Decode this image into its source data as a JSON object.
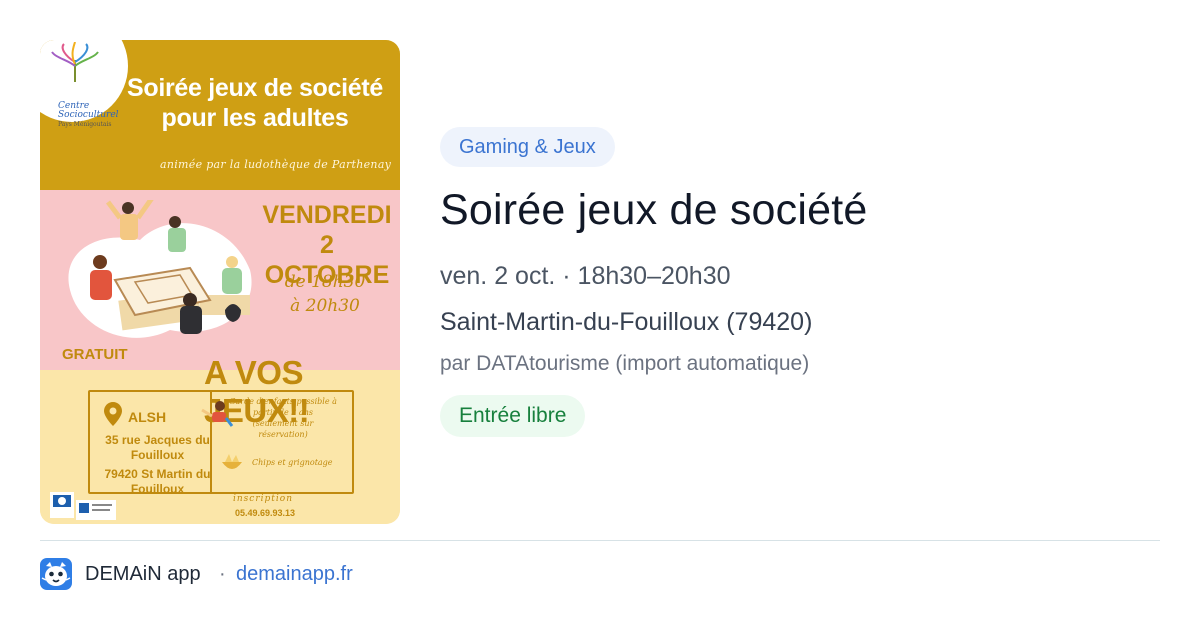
{
  "poster": {
    "logo_text": "Centre Socioculturel",
    "logo_subtext": "Pays Ménigoutais",
    "title_line1": "Soirée jeux de société",
    "title_line2": "pour les adultes",
    "animated_by": "animée par la ludothèque de Parthenay",
    "day": "VENDREDI",
    "date": "2 OCTOBRE",
    "time_from": "de 18h30",
    "time_to": "à 20h30",
    "price": "GRATUIT",
    "slogan": "A VOS JEUX!!",
    "venue_name": "ALSH",
    "address_line1": "35 rue Jacques du Fouilloux",
    "address_line2": "79420 St Martin du Fouilloux",
    "childcare": "Garde d'enfants possible à partir de 3 ans",
    "childcare_note": "(seulement sur réservation)",
    "snacks": "Chips et grignotage",
    "registration_label": "inscription",
    "phone": "05.49.69.93.13"
  },
  "event": {
    "category": "Gaming & Jeux",
    "title": "Soirée jeux de société",
    "datetime": "ven. 2 oct. · 18h30–20h30",
    "location": "Saint-Martin-du-Fouilloux (79420)",
    "source": "par DATAtourisme (import automatique)",
    "price_badge": "Entrée libre"
  },
  "footer": {
    "app_name": "DEMAiN app",
    "separator": "·",
    "link": "demainapp.fr"
  },
  "colors": {
    "tag_bg": "#eef3fc",
    "tag_text": "#3b74d1",
    "badge_bg": "#ecfaf0",
    "badge_text": "#17803d",
    "poster_gold": "#cf9f14",
    "poster_pink": "#f8c6c8",
    "poster_cream": "#fbe6a9"
  }
}
